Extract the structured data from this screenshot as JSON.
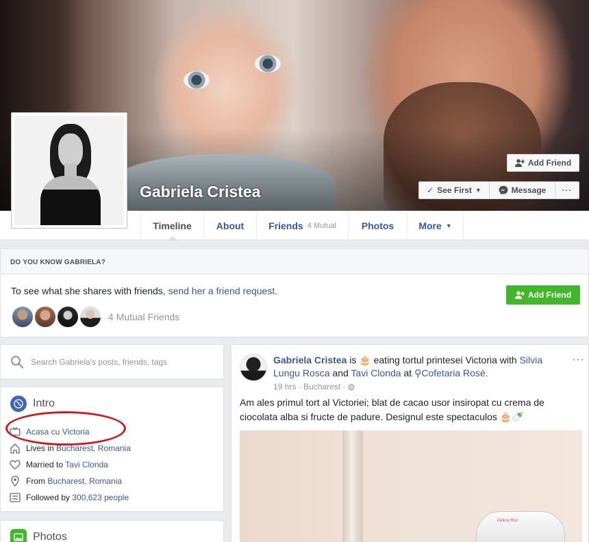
{
  "profile": {
    "name": "Gabriela Cristea"
  },
  "cover_actions": {
    "add_friend": "Add Friend",
    "see_first": "See First",
    "message": "Message",
    "more": "···"
  },
  "tabs": [
    {
      "label": "Timeline",
      "active": true
    },
    {
      "label": "About"
    },
    {
      "label": "Friends",
      "sub": "4 Mutual"
    },
    {
      "label": "Photos"
    },
    {
      "label": "More"
    }
  ],
  "know_card": {
    "heading": "DO YOU KNOW GABRIELA?",
    "text_prefix": "To see what she shares with friends, ",
    "text_link": "send her a friend request.",
    "button": "Add Friend",
    "mutual_label": "4 Mutual Friends"
  },
  "search": {
    "placeholder": "Search Gabriela's posts, friends, tags"
  },
  "intro": {
    "title": "Intro",
    "items": [
      {
        "icon": "tv-icon",
        "link": "Acasa cu Victoria"
      },
      {
        "icon": "home-icon",
        "prefix": "Lives in ",
        "link": "Bucharest, Romania"
      },
      {
        "icon": "heart-icon",
        "prefix": "Married to ",
        "link": "Tavi Clonda"
      },
      {
        "icon": "location-pin-icon",
        "prefix": "From ",
        "link": "Bucharest, Romania"
      },
      {
        "icon": "followers-icon",
        "prefix": "Followed by ",
        "link": "300,623 people"
      }
    ]
  },
  "photos_card": {
    "title": "Photos"
  },
  "post": {
    "author": "Gabriela Cristea",
    "is_text": " is ",
    "activity": " eating tortul printesei Victoria with ",
    "with_1": "Silvia Lungu Rosca",
    "and_text": " and ",
    "with_2": "Tavi Clonda",
    "at_text": " at ",
    "place": "Cofetaria Rosé.",
    "time": "19 hrs",
    "location": "Bucharest",
    "body": "Am ales primul tort al Victoriei; blat de cacao usor insiropat cu crema de ciocolata alba si fructe de padure. Designul este spectaculos",
    "photo_text": "Deliciu Roz",
    "more": "···"
  },
  "colors": {
    "link": "#365899",
    "brand_blue": "#4267b2",
    "green": "#42b72a",
    "annotation_red": "#d0181f",
    "page_bg": "#e9ebee"
  }
}
